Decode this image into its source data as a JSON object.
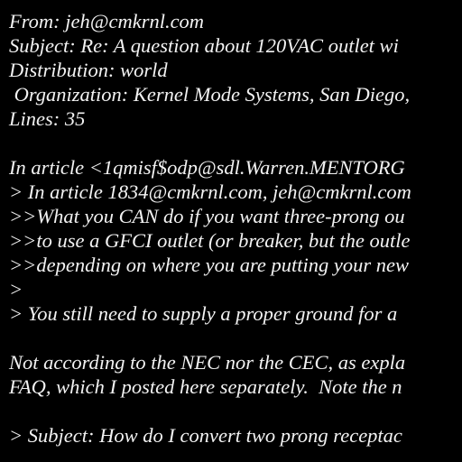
{
  "colors": {
    "background": "#000000",
    "text": "#f2f2f2"
  },
  "header": {
    "from": "From: jeh@cmkrnl.com",
    "subject": "Subject: Re: A question about 120VAC outlet wi",
    "distribution": "Distribution: world",
    "organization": " Organization: Kernel Mode Systems, San Diego,",
    "lines": "Lines: 35"
  },
  "body": {
    "line1": "In article <1qmisf$odp@sdl.Warren.MENTORG",
    "line2": "> In article 1834@cmkrnl.com, jeh@cmkrnl.com",
    "line3": ">>What you CAN do if you want three-prong ou",
    "line4": ">>to use a GFCI outlet (or breaker, but the outle",
    "line5": ">>depending on where you are putting your new",
    "line6": ">",
    "line7": "> You still need to supply a proper ground for a",
    "line8": "Not according to the NEC nor the CEC, as expla",
    "line9": "FAQ, which I posted here separately.  Note the n",
    "line10": "> Subject: How do I convert two prong receptac"
  }
}
